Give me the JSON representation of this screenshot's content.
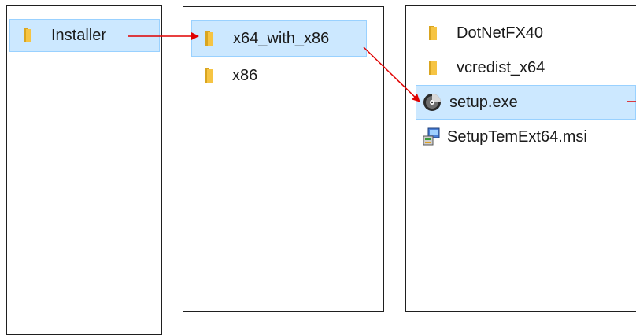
{
  "panel1": {
    "items": [
      {
        "label": "Installer",
        "icon": "folder-icon",
        "selected": true
      }
    ]
  },
  "panel2": {
    "items": [
      {
        "label": "x64_with_x86",
        "icon": "folder-icon",
        "selected": true
      },
      {
        "label": "x86",
        "icon": "folder-icon",
        "selected": false
      }
    ]
  },
  "panel3": {
    "items": [
      {
        "label": "DotNetFX40",
        "icon": "folder-icon",
        "selected": false
      },
      {
        "label": "vcredist_x64",
        "icon": "folder-icon",
        "selected": false
      },
      {
        "label": "setup.exe",
        "icon": "setup-disc-icon",
        "selected": true
      },
      {
        "label": "SetupTemExt64.msi",
        "icon": "msi-installer-icon",
        "selected": false
      }
    ]
  },
  "colors": {
    "selection_bg": "#cce8ff",
    "selection_border": "#99d1ff",
    "arrow": "#e00000",
    "folder": "#f6c443"
  }
}
